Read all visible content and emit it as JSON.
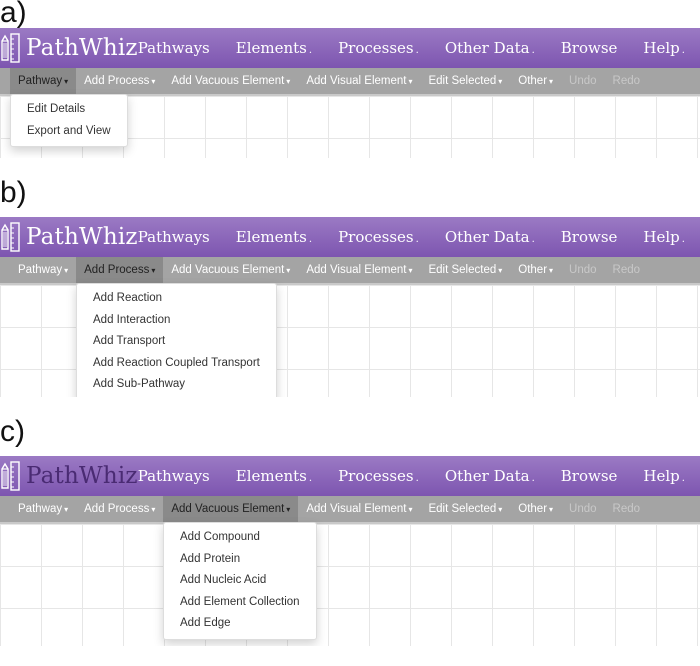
{
  "app": {
    "name": "PathWhiz",
    "logo_icon": "pencil-ruler-icon"
  },
  "nav": [
    {
      "label": "Pathways",
      "has_caret": false
    },
    {
      "label": "Elements",
      "has_caret": true
    },
    {
      "label": "Processes",
      "has_caret": true
    },
    {
      "label": "Other Data",
      "has_caret": true
    },
    {
      "label": "Browse",
      "has_caret": false
    },
    {
      "label": "Help",
      "has_caret": true
    }
  ],
  "toolbar": [
    {
      "label": "Pathway",
      "has_caret": true,
      "disabled": false
    },
    {
      "label": "Add Process",
      "has_caret": true,
      "disabled": false
    },
    {
      "label": "Add Vacuous Element",
      "has_caret": true,
      "disabled": false
    },
    {
      "label": "Add Visual Element",
      "has_caret": true,
      "disabled": false
    },
    {
      "label": "Edit Selected",
      "has_caret": true,
      "disabled": false
    },
    {
      "label": "Other",
      "has_caret": true,
      "disabled": false
    },
    {
      "label": "Undo",
      "has_caret": false,
      "disabled": true
    },
    {
      "label": "Redo",
      "has_caret": false,
      "disabled": true
    }
  ],
  "caret_glyph": "▾",
  "panels": [
    {
      "label": "a)",
      "active_menu": "Pathway",
      "dropdown_items": [
        "Edit Details",
        "Export and View"
      ]
    },
    {
      "label": "b)",
      "active_menu": "Add Process",
      "dropdown_items": [
        "Add Reaction",
        "Add Interaction",
        "Add Transport",
        "Add Reaction Coupled Transport",
        "Add Sub-Pathway"
      ]
    },
    {
      "label": "c)",
      "active_menu": "Add Vacuous Element",
      "dropdown_items": [
        "Add Compound",
        "Add Protein",
        "Add Nucleic Acid",
        "Add Element Collection",
        "Add Edge"
      ]
    }
  ],
  "colors": {
    "header_purple": "#8a63bb",
    "toolbar_gray": "#a4a4a4",
    "active_gray": "#8a8a8a"
  }
}
